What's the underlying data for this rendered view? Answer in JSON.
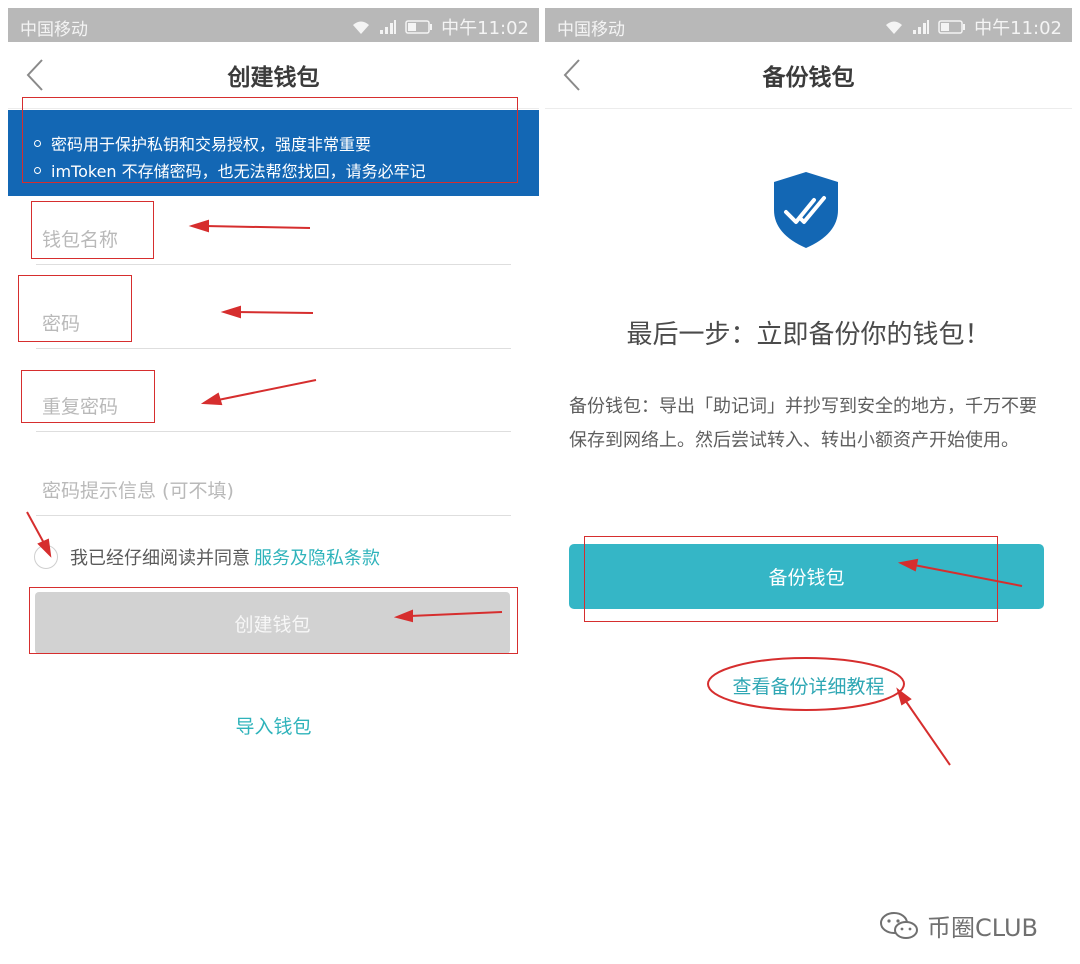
{
  "status_bar": {
    "carrier": "中国移动",
    "time": "中午11:02"
  },
  "left": {
    "title": "创建钱包",
    "notices": [
      "密码用于保护私钥和交易授权，强度非常重要",
      "imToken 不存储密码，也无法帮您找回，请务必牢记"
    ],
    "fields": {
      "wallet_name_placeholder": "钱包名称",
      "password_placeholder": "密码",
      "repeat_password_placeholder": "重复密码",
      "hint_placeholder": "密码提示信息 (可不填)"
    },
    "agree_text": "我已经仔细阅读并同意",
    "terms_link": "服务及隐私条款",
    "create_button": "创建钱包",
    "import_link": "导入钱包"
  },
  "right": {
    "title": "备份钱包",
    "heading": "最后一步：立即备份你的钱包！",
    "description": "备份钱包：导出「助记词」并抄写到安全的地方，千万不要保存到网络上。然后尝试转入、转出小额资产开始使用。",
    "backup_button": "备份钱包",
    "tutorial_link": "查看备份详细教程"
  },
  "watermark": "币圈CLUB",
  "colors": {
    "primary_blue": "#1367b4",
    "teal": "#35b6c6",
    "annotation_red": "#d62e2e",
    "disabled_gray": "#d2d2d2"
  },
  "icons": [
    "back-arrow-icon",
    "wifi-icon",
    "signal-icon",
    "battery-icon",
    "shield-check-icon",
    "radio-icon",
    "wechat-icon"
  ]
}
